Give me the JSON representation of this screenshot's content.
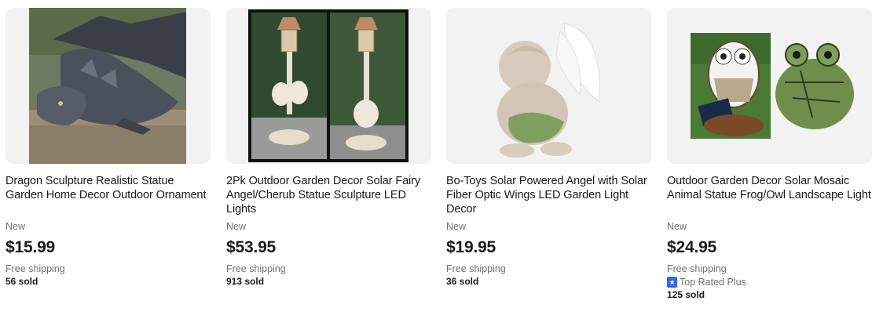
{
  "listings": [
    {
      "title": "Dragon Sculpture Realistic Statue Garden Home Decor Outdoor Ornament",
      "condition": "New",
      "price": "$15.99",
      "shipping": "Free shipping",
      "sold": "56 sold",
      "image_icon": "dragon-statue-photo"
    },
    {
      "title": "2Pk Outdoor Garden Decor Solar Fairy Angel/Cherub Statue Sculpture LED Lights",
      "condition": "New",
      "price": "$53.95",
      "shipping": "Free shipping",
      "sold": "913 sold",
      "image_icon": "cherub-lamp-photo"
    },
    {
      "title": "Bo-Toys Solar Powered Angel with Solar Fiber Optic Wings LED Garden Light Decor",
      "condition": "New",
      "price": "$19.95",
      "shipping": "Free shipping",
      "sold": "36 sold",
      "image_icon": "angel-statue-photo"
    },
    {
      "title": "Outdoor Garden Decor Solar Mosaic Animal Statue Frog/Owl Landscape Light",
      "condition": "New",
      "price": "$24.95",
      "shipping": "Free shipping",
      "top_rated": "Top Rated Plus",
      "sold": "125 sold",
      "image_icon": "owl-frog-mosaic-photo"
    }
  ],
  "colors": {
    "text": "#191919",
    "secondary": "#707070",
    "image_bg": "#f2f2f2",
    "badge": "#3665f3"
  }
}
